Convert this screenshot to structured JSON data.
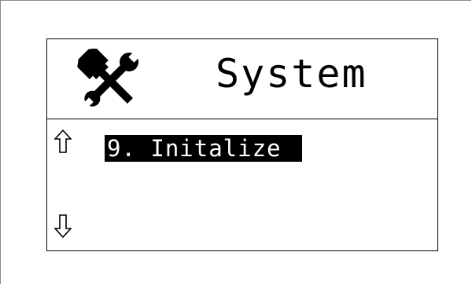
{
  "screen": {
    "title": "System",
    "icon": "tools-icon"
  },
  "menu": {
    "selected_item": "9. Initalize",
    "scroll_up_icon": "arrow-up-icon",
    "scroll_down_icon": "arrow-down-icon"
  },
  "colors": {
    "background": "#ffffff",
    "foreground": "#000000",
    "highlight_text": "#ffffff",
    "outer_frame": "#8a8a8a"
  }
}
